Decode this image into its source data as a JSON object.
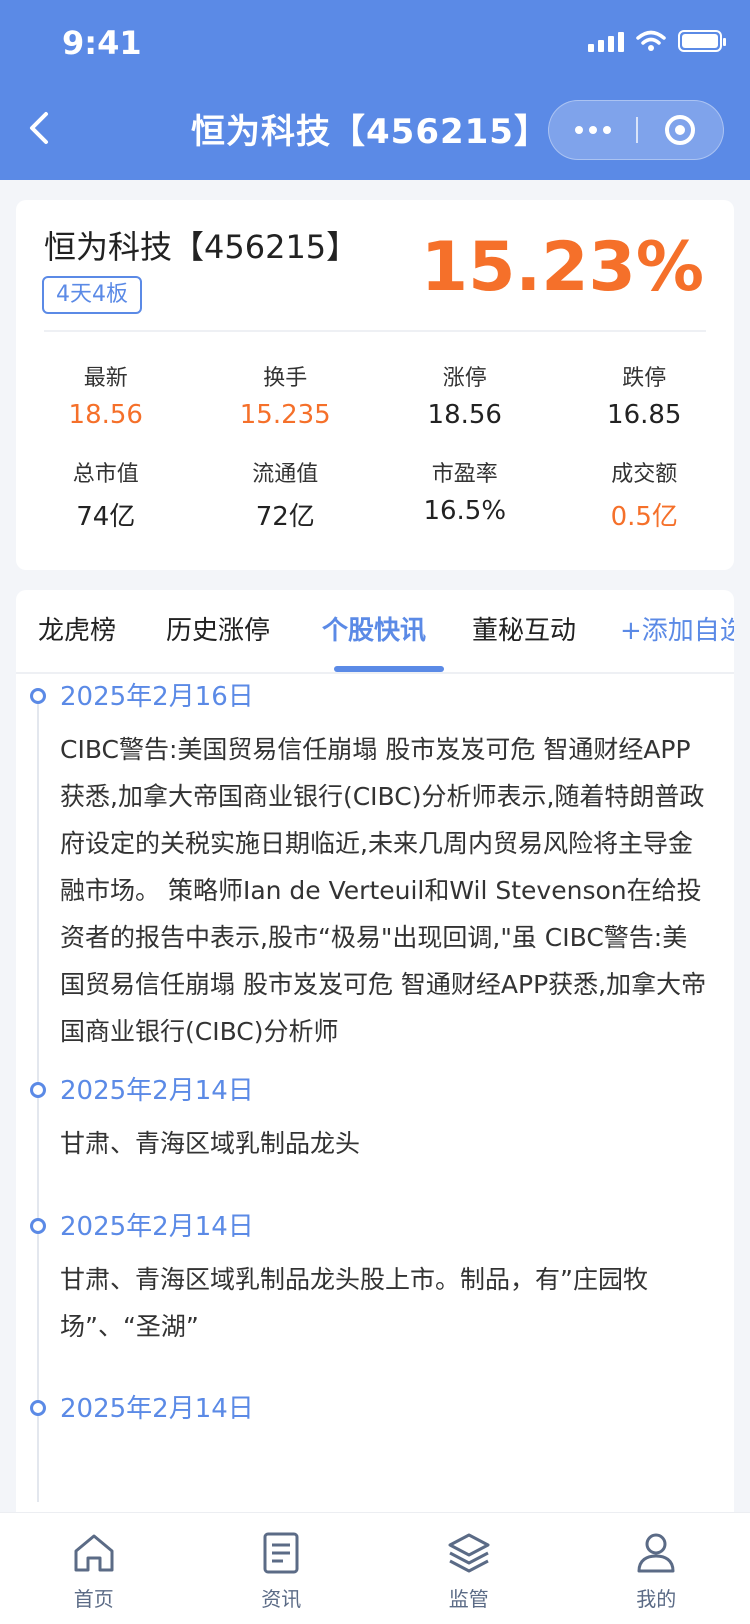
{
  "status_bar": {
    "time": "9:41"
  },
  "header": {
    "title": "恒为科技【456215】"
  },
  "stock": {
    "name": "恒为科技【456215】",
    "badge": "4天4板",
    "change": "15.23%",
    "metrics": [
      {
        "label": "最新",
        "value": "18.56"
      },
      {
        "label": "换手",
        "value": "15.235"
      },
      {
        "label": "涨停",
        "value": "18.56"
      },
      {
        "label": "跌停",
        "value": "16.85"
      },
      {
        "label": "总市值",
        "value": "74亿"
      },
      {
        "label": "流通值",
        "value": "72亿"
      },
      {
        "label": "市盈率",
        "value": "16.5%"
      },
      {
        "label": "成交额",
        "value": "0.5亿"
      }
    ]
  },
  "tabs": [
    {
      "label": "龙虎榜"
    },
    {
      "label": "历史涨停"
    },
    {
      "label": "个股快讯"
    },
    {
      "label": "董秘互动"
    },
    {
      "label": "+添加自选"
    }
  ],
  "news": [
    {
      "date": "2025年2月16日",
      "text": " CIBC警告:美国贸易信任崩塌 股市岌岌可危 智通财经APP获悉,加拿大帝国商业银行(CIBC)分析师表示,随着特朗普政府设定的关税实施日期临近,未来几周内贸易风险将主导金融市场。 策略师Ian de Verteuil和Wil Stevenson在给投资者的报告中表示,股市“极易\"出现回调,\"虽 CIBC警告:美国贸易信任崩塌 股市岌岌可危 智通财经APP获悉,加拿大帝国商业银行(CIBC)分析师"
    },
    {
      "date": "2025年2月14日",
      "text": "甘肃、青海区域乳制品龙头"
    },
    {
      "date": "2025年2月14日",
      "text": "甘肃、青海区域乳制品龙头股上市。制品，有”庄园牧场”、“圣湖”"
    },
    {
      "date": "2025年2月14日",
      "text": ""
    }
  ],
  "bottom_nav": [
    {
      "label": "首页",
      "icon": "home-icon"
    },
    {
      "label": "资讯",
      "icon": "news-icon"
    },
    {
      "label": "监管",
      "icon": "layers-icon"
    },
    {
      "label": "我的",
      "icon": "user-icon"
    }
  ],
  "colors": {
    "primary": "#5b8ae6",
    "hot": "#f5702a"
  }
}
